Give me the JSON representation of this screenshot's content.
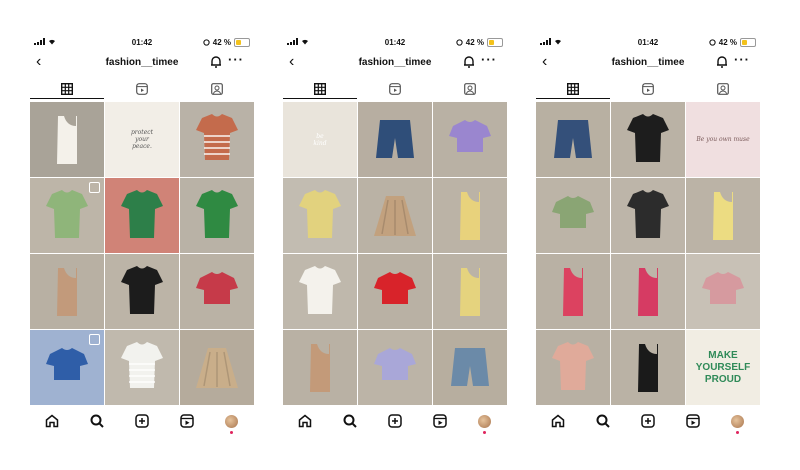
{
  "panels": [
    {
      "status": {
        "time": "01:42",
        "battery": "42 %"
      },
      "username": "fashion__timee",
      "tiles": [
        {
          "bg": "#a9a398",
          "fg": "#f4f1ea",
          "shape": "tank",
          "label": ""
        },
        {
          "bg": "#f2eee7",
          "fg": "#555",
          "shape": "text",
          "label": "protect\nyour\npeace."
        },
        {
          "bg": "#b9b2a7",
          "fg": "#c46b4c",
          "shape": "stripe",
          "label": ""
        },
        {
          "bg": "#bdb5a8",
          "fg": "#8fb57a",
          "shape": "shirt",
          "label": "",
          "badge": true
        },
        {
          "bg": "#d08377",
          "fg": "#2d7f49",
          "shape": "shirt",
          "label": ""
        },
        {
          "bg": "#b9b2a6",
          "fg": "#2f8a42",
          "shape": "shirt",
          "label": ""
        },
        {
          "bg": "#b8b0a3",
          "fg": "#c29a7b",
          "shape": "tank",
          "label": ""
        },
        {
          "bg": "#bcb4a7",
          "fg": "#1c1c1c",
          "shape": "shirt",
          "label": ""
        },
        {
          "bg": "#bab2a5",
          "fg": "#c63a49",
          "shape": "crop",
          "label": ""
        },
        {
          "bg": "#9fb2d1",
          "fg": "#2f5ea8",
          "shape": "crop",
          "label": "",
          "badge": true
        },
        {
          "bg": "#c0b9ad",
          "fg": "#f2f2ee",
          "shape": "stripe",
          "label": ""
        },
        {
          "bg": "#b5ab9c",
          "fg": "#c9ae8a",
          "shape": "skirt",
          "label": ""
        }
      ]
    },
    {
      "status": {
        "time": "01:42",
        "battery": "42 %"
      },
      "username": "fashion__timee",
      "tiles": [
        {
          "bg": "#e9e4db",
          "fg": "#ffffff",
          "shape": "text",
          "label": "be\nkind"
        },
        {
          "bg": "#b7aea1",
          "fg": "#2f4e79",
          "shape": "shorts",
          "label": ""
        },
        {
          "bg": "#b9b1a4",
          "fg": "#9a86cf",
          "shape": "crop",
          "label": ""
        },
        {
          "bg": "#c2bcb1",
          "fg": "#e2d27e",
          "shape": "shirt",
          "label": ""
        },
        {
          "bg": "#bab2a5",
          "fg": "#c2a17e",
          "shape": "skirt",
          "label": ""
        },
        {
          "bg": "#bbb3a6",
          "fg": "#e8d27c",
          "shape": "tank",
          "label": ""
        },
        {
          "bg": "#bfb8ac",
          "fg": "#f4f2ec",
          "shape": "shirt",
          "label": ""
        },
        {
          "bg": "#b9b1a4",
          "fg": "#d8232a",
          "shape": "crop",
          "label": ""
        },
        {
          "bg": "#bbb3a6",
          "fg": "#e5d37e",
          "shape": "tank",
          "label": ""
        },
        {
          "bg": "#b9b1a4",
          "fg": "#c39a79",
          "shape": "tank",
          "label": ""
        },
        {
          "bg": "#bcb4a7",
          "fg": "#a9a7d8",
          "shape": "crop",
          "label": ""
        },
        {
          "bg": "#b7ae9f",
          "fg": "#6b8aa8",
          "shape": "shorts",
          "label": ""
        }
      ]
    },
    {
      "status": {
        "time": "01:42",
        "battery": "42 %"
      },
      "username": "fashion__timee",
      "tiles": [
        {
          "bg": "#b8b0a2",
          "fg": "#34507a",
          "shape": "shorts",
          "label": ""
        },
        {
          "bg": "#bab2a5",
          "fg": "#1d1d1d",
          "shape": "shirt",
          "label": ""
        },
        {
          "bg": "#f0dfe0",
          "fg": "#7a5a5a",
          "shape": "text",
          "label": "Be you own muse"
        },
        {
          "bg": "#bcb4a7",
          "fg": "#8aa574",
          "shape": "crop",
          "label": ""
        },
        {
          "bg": "#bdb5a9",
          "fg": "#2c2c2c",
          "shape": "shirt",
          "label": ""
        },
        {
          "bg": "#bbb3a6",
          "fg": "#ecdc82",
          "shape": "tank",
          "label": ""
        },
        {
          "bg": "#b9b1a4",
          "fg": "#dc4260",
          "shape": "tank",
          "label": ""
        },
        {
          "bg": "#bdb5a9",
          "fg": "#d63b63",
          "shape": "tank",
          "label": ""
        },
        {
          "bg": "#c8c1b6",
          "fg": "#d69a9f",
          "shape": "crop",
          "label": ""
        },
        {
          "bg": "#b8b0a3",
          "fg": "#e0aa9a",
          "shape": "shirt",
          "label": ""
        },
        {
          "bg": "#bab2a5",
          "fg": "#1a1a1a",
          "shape": "tank",
          "label": ""
        },
        {
          "bg": "#f1ede3",
          "fg": "#2f8a58",
          "shape": "bigtext",
          "label": "MAKE\nYOURSELF\nPROUD"
        }
      ]
    }
  ]
}
